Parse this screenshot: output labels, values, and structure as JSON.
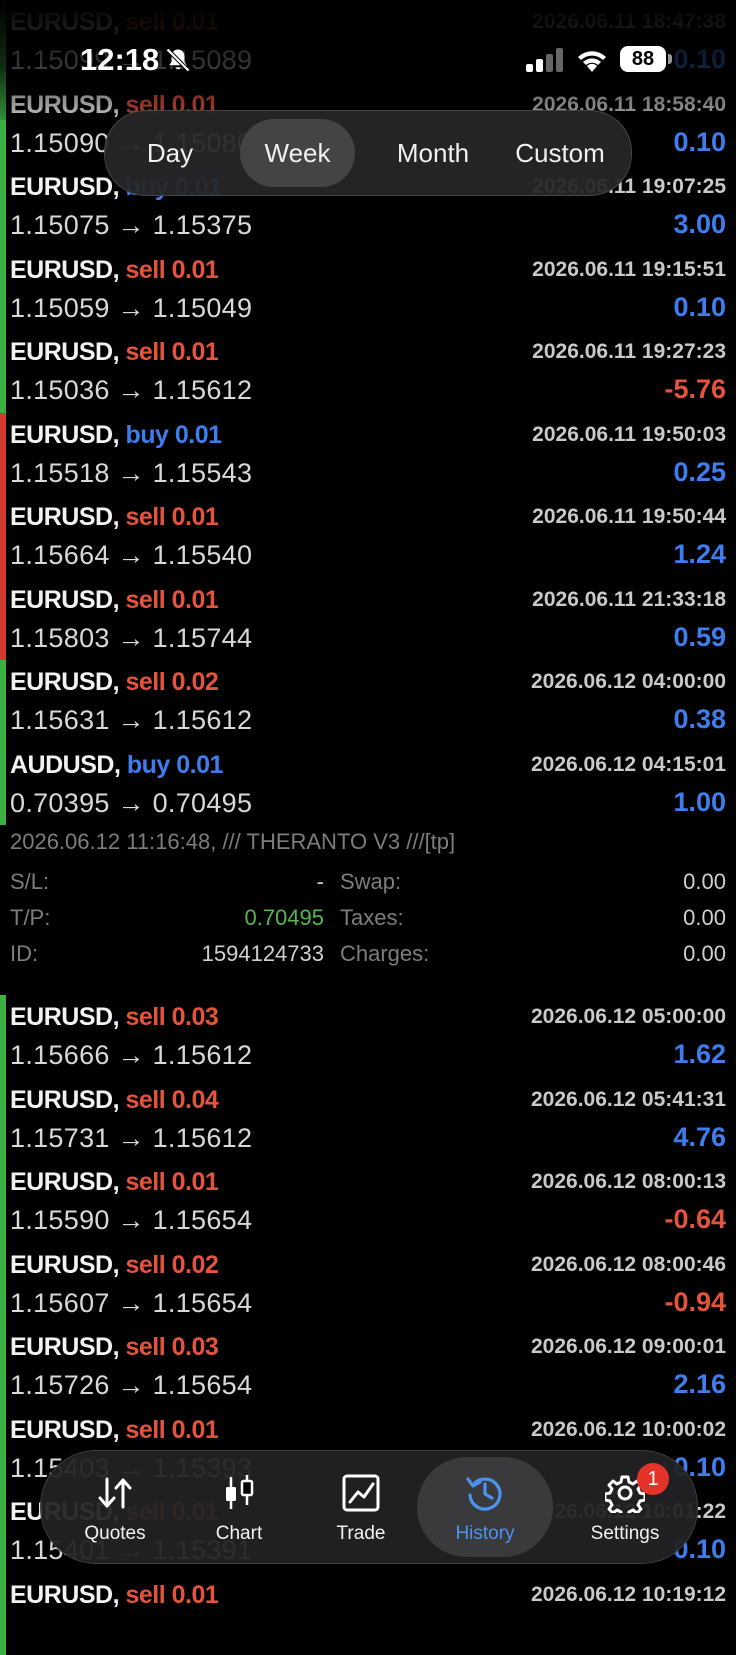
{
  "status_bar": {
    "time": "12:18",
    "battery": "88"
  },
  "period_tabs": [
    {
      "label": "Day",
      "active": false
    },
    {
      "label": "Week",
      "active": true
    },
    {
      "label": "Month",
      "active": false
    },
    {
      "label": "Custom",
      "active": false
    }
  ],
  "colors": {
    "sell": "#e5533d",
    "buy": "#3d7dee",
    "profit_positive": "#3d7dee",
    "profit_negative": "#e5533d",
    "stripe_green": "#3cb043",
    "stripe_red": "#d23a30"
  },
  "deals": [
    {
      "symbol": "EURUSD,",
      "side": "sell",
      "volume": "0.01",
      "time": "2026.06.11 18:47:38",
      "prices": "1.15099 → 1.15089",
      "profit": "0.10",
      "stripe": "green"
    },
    {
      "symbol": "EURUSD,",
      "side": "sell",
      "volume": "0.01",
      "time": "2026.06.11 18:58:40",
      "prices": "1.15090 → 1.15080",
      "profit": "0.10",
      "stripe": "green"
    },
    {
      "symbol": "EURUSD,",
      "side": "buy",
      "volume": "0.01",
      "time": "2026.06.11 19:07:25",
      "prices": "1.15075 → 1.15375",
      "profit": "3.00",
      "stripe": "green"
    },
    {
      "symbol": "EURUSD,",
      "side": "sell",
      "volume": "0.01",
      "time": "2026.06.11 19:15:51",
      "prices": "1.15059 → 1.15049",
      "profit": "0.10",
      "stripe": "green"
    },
    {
      "symbol": "EURUSD,",
      "side": "sell",
      "volume": "0.01",
      "time": "2026.06.11 19:27:23",
      "prices": "1.15036 → 1.15612",
      "profit": "-5.76",
      "stripe": "green"
    },
    {
      "symbol": "EURUSD,",
      "side": "buy",
      "volume": "0.01",
      "time": "2026.06.11 19:50:03",
      "prices": "1.15518 → 1.15543",
      "profit": "0.25",
      "stripe": "red"
    },
    {
      "symbol": "EURUSD,",
      "side": "sell",
      "volume": "0.01",
      "time": "2026.06.11 19:50:44",
      "prices": "1.15664 → 1.15540",
      "profit": "1.24",
      "stripe": "red"
    },
    {
      "symbol": "EURUSD,",
      "side": "sell",
      "volume": "0.01",
      "time": "2026.06.11 21:33:18",
      "prices": "1.15803 → 1.15744",
      "profit": "0.59",
      "stripe": "red"
    },
    {
      "symbol": "EURUSD,",
      "side": "sell",
      "volume": "0.02",
      "time": "2026.06.12 04:00:00",
      "prices": "1.15631 → 1.15612",
      "profit": "0.38",
      "stripe": "green"
    },
    {
      "symbol": "AUDUSD,",
      "side": "buy",
      "volume": "0.01",
      "time": "2026.06.12 04:15:01",
      "prices": "0.70395 → 0.70495",
      "profit": "1.00",
      "stripe": "green"
    }
  ],
  "detail": {
    "comment": "2026.06.12 11:16:48, /// THERANTO V3 ///[tp]",
    "sl_label": "S/L:",
    "sl_value": "-",
    "tp_label": "T/P:",
    "tp_value": "0.70495",
    "id_label": "ID:",
    "id_value": "1594124733",
    "swap_label": "Swap:",
    "swap_value": "0.00",
    "taxes_label": "Taxes:",
    "taxes_value": "0.00",
    "charges_label": "Charges:",
    "charges_value": "0.00"
  },
  "deals_after": [
    {
      "symbol": "EURUSD,",
      "side": "sell",
      "volume": "0.03",
      "time": "2026.06.12 05:00:00",
      "prices": "1.15666 → 1.15612",
      "profit": "1.62",
      "stripe": "green"
    },
    {
      "symbol": "EURUSD,",
      "side": "sell",
      "volume": "0.04",
      "time": "2026.06.12 05:41:31",
      "prices": "1.15731 → 1.15612",
      "profit": "4.76",
      "stripe": "green"
    },
    {
      "symbol": "EURUSD,",
      "side": "sell",
      "volume": "0.01",
      "time": "2026.06.12 08:00:13",
      "prices": "1.15590 → 1.15654",
      "profit": "-0.64",
      "stripe": "green"
    },
    {
      "symbol": "EURUSD,",
      "side": "sell",
      "volume": "0.02",
      "time": "2026.06.12 08:00:46",
      "prices": "1.15607 → 1.15654",
      "profit": "-0.94",
      "stripe": "green"
    },
    {
      "symbol": "EURUSD,",
      "side": "sell",
      "volume": "0.03",
      "time": "2026.06.12 09:00:01",
      "prices": "1.15726 → 1.15654",
      "profit": "2.16",
      "stripe": "green"
    },
    {
      "symbol": "EURUSD,",
      "side": "sell",
      "volume": "0.01",
      "time": "2026.06.12 10:00:02",
      "prices": "1.15403 → 1.15393",
      "profit": "0.10",
      "stripe": "green"
    },
    {
      "symbol": "EURUSD,",
      "side": "sell",
      "volume": "0.01",
      "time": "2026.06.12 10:01:22",
      "prices": "1.15401 → 1.15391",
      "profit": "0.10",
      "stripe": "green"
    },
    {
      "symbol": "EURUSD,",
      "side": "sell",
      "volume": "0.01",
      "time": "2026.06.12 10:19:12",
      "prices": "",
      "profit": "",
      "stripe": "green"
    }
  ],
  "tabbar": [
    {
      "label": "Quotes",
      "icon": "quotes-arrows-icon",
      "active": false
    },
    {
      "label": "Chart",
      "icon": "candlestick-icon",
      "active": false
    },
    {
      "label": "Trade",
      "icon": "trade-chart-icon",
      "active": false
    },
    {
      "label": "History",
      "icon": "history-clock-icon",
      "active": true
    },
    {
      "label": "Settings",
      "icon": "gear-icon",
      "active": false,
      "badge": "1"
    }
  ]
}
